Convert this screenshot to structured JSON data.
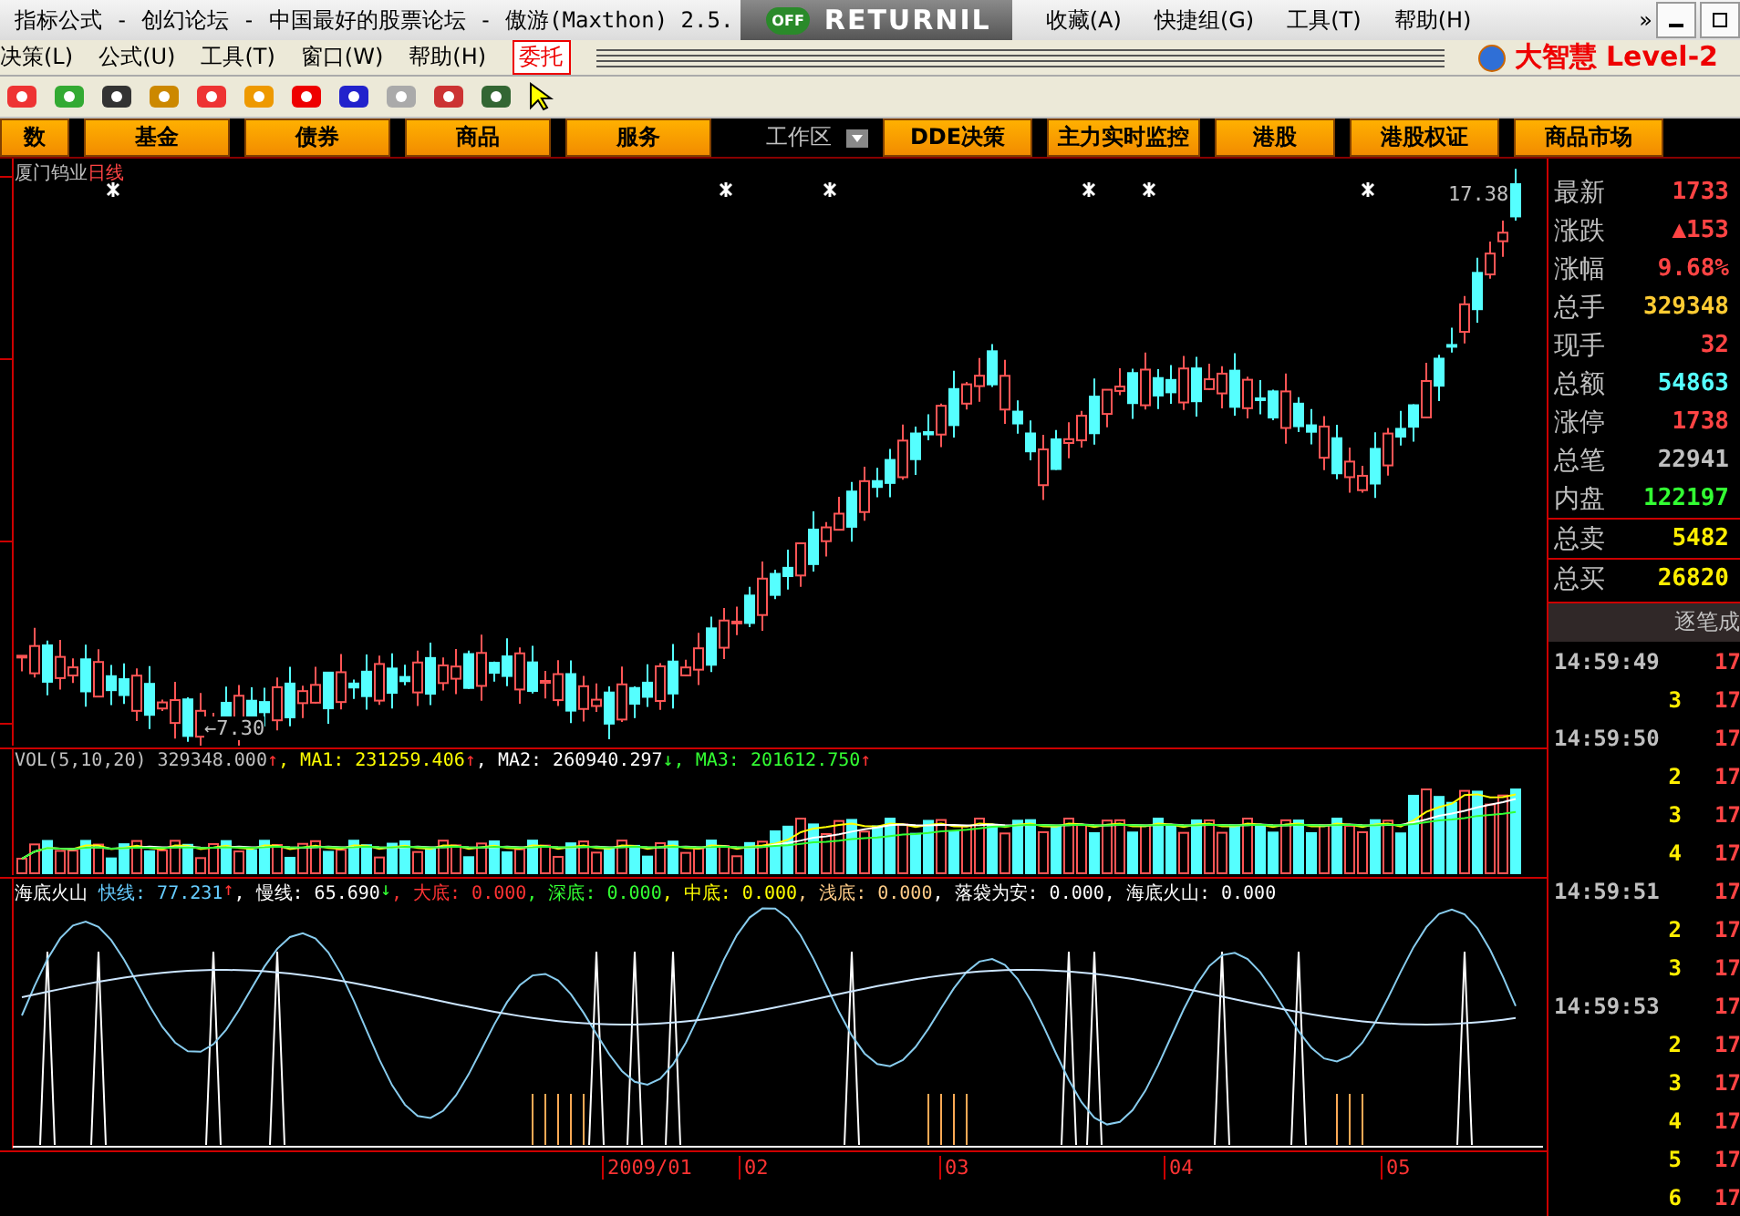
{
  "window": {
    "title": "指标公式 - 创幻论坛 - 中国最好的股票论坛 - 傲游(Maxthon) 2.5.",
    "overlay": {
      "badge": "OFF",
      "label": "RETURNIL"
    },
    "menu": [
      "收藏(A)",
      "快捷组(G)",
      "工具(T)",
      "帮助(H)"
    ],
    "more": "»"
  },
  "app_menu": {
    "items": [
      {
        "label": "决策(L)",
        "kind": "plain"
      },
      {
        "label": "公式(U)",
        "kind": "plain"
      },
      {
        "label": "工具(T)",
        "kind": "plain"
      },
      {
        "label": "窗口(W)",
        "kind": "plain"
      },
      {
        "label": "帮助(H)",
        "kind": "plain"
      },
      {
        "label": "委托",
        "kind": "boxed"
      }
    ],
    "brand": {
      "name": "大智慧",
      "edition": "Level-2"
    }
  },
  "nav_buttons": [
    "数",
    "基金",
    "债券",
    "商品",
    "服务"
  ],
  "workspace": {
    "label": "工作区"
  },
  "shortcut_buttons": [
    "DDE决策",
    "主力实时监控",
    "港股",
    "港股权证",
    "商品市场"
  ],
  "chart": {
    "stock": "厦门钨业",
    "period": "日线",
    "high_label": "17.38",
    "low_label": "←7.30",
    "volume_legend": [
      {
        "text": "VOL(5,10,20) 329348.000",
        "arrow": "↑",
        "color": "#c0c0c0"
      },
      {
        "text": ", MA1: 231259.406",
        "arrow": "↑",
        "color": "#ffff00"
      },
      {
        "text": ", MA2: 260940.297",
        "arrow": "↓",
        "color": "#ffffff"
      },
      {
        "text": ", MA3: 201612.750",
        "arrow": "↑",
        "color": "#33ff33"
      }
    ],
    "indicator_legend": [
      {
        "text": "海底火山",
        "color": "#ffffff"
      },
      {
        "text": " 快线: 77.231",
        "arrow": "↑",
        "color": "#66ccff"
      },
      {
        "text": ", 慢线: 65.690",
        "arrow": "↓",
        "color": "#ffffff"
      },
      {
        "text": ", 大底: 0.000",
        "color": "#ff3333"
      },
      {
        "text": ", 深底: 0.000",
        "color": "#33ff33"
      },
      {
        "text": ", 中底: 0.000",
        "color": "#ffff00"
      },
      {
        "text": ", 浅底: 0.000",
        "color": "#ffcc88"
      },
      {
        "text": ", 落袋为安: 0.000",
        "color": "#ffffff"
      },
      {
        "text": ", 海底火山: 0.000",
        "color": "#ffffff"
      }
    ],
    "date_labels": [
      "2009/01",
      "02",
      "03",
      "04",
      "05"
    ]
  },
  "quote": {
    "rows": [
      {
        "label": "最新",
        "value": "1733",
        "color": "#ff4444"
      },
      {
        "label": "涨跌",
        "value": "▲153",
        "color": "#ff4444"
      },
      {
        "label": "涨幅",
        "value": "9.68%",
        "color": "#ff4444"
      },
      {
        "label": "总手",
        "value": "329348",
        "color": "#ffcc33"
      },
      {
        "label": "现手",
        "value": "32",
        "color": "#ff4444"
      },
      {
        "label": "总额",
        "value": "54863",
        "color": "#55ffff"
      },
      {
        "label": "涨停",
        "value": "1738",
        "color": "#ff4444"
      },
      {
        "label": "总笔",
        "value": "22941",
        "color": "#c0c0c0"
      },
      {
        "label": "内盘",
        "value": "122197",
        "color": "#33ff33"
      },
      {
        "label": "总卖",
        "value": "5482",
        "color": "#ffee00"
      },
      {
        "label": "总买",
        "value": "26820",
        "color": "#ffee00"
      }
    ],
    "ticks_title": "逐笔成",
    "ticks": [
      {
        "kind": "time",
        "text": "14:59:49",
        "price": "17"
      },
      {
        "kind": "count",
        "text": "3",
        "price": "17"
      },
      {
        "kind": "time",
        "text": "14:59:50",
        "price": "17"
      },
      {
        "kind": "count",
        "text": "2",
        "price": "17"
      },
      {
        "kind": "count",
        "text": "3",
        "price": "17"
      },
      {
        "kind": "count",
        "text": "4",
        "price": "17"
      },
      {
        "kind": "time",
        "text": "14:59:51",
        "price": "17"
      },
      {
        "kind": "count",
        "text": "2",
        "price": "17"
      },
      {
        "kind": "count",
        "text": "3",
        "price": "17"
      },
      {
        "kind": "time",
        "text": "14:59:53",
        "price": "17"
      },
      {
        "kind": "count",
        "text": "2",
        "price": "17"
      },
      {
        "kind": "count",
        "text": "3",
        "price": "17"
      },
      {
        "kind": "count",
        "text": "4",
        "price": "17"
      },
      {
        "kind": "count",
        "text": "5",
        "price": "17"
      },
      {
        "kind": "count",
        "text": "6",
        "price": "17"
      }
    ]
  }
}
